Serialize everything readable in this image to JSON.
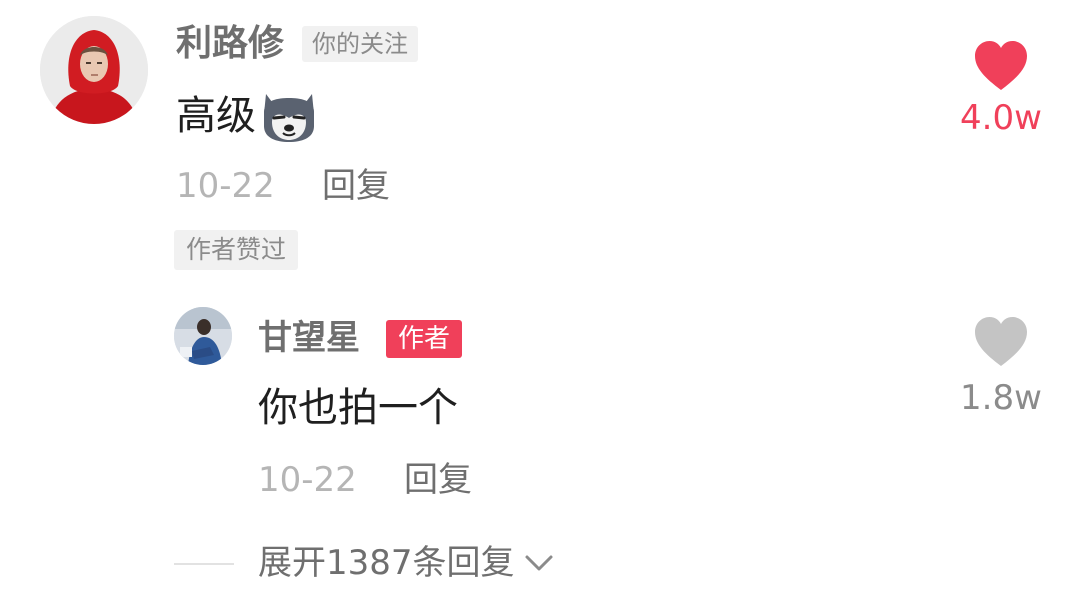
{
  "comment": {
    "username": "利路修",
    "following_tag": "你的关注",
    "text": "高级",
    "emoji_icon": "husky-dog-emoji",
    "date": "10-22",
    "reply_label": "回复",
    "author_liked_tag": "作者赞过",
    "likes": "4.0w",
    "liked": true,
    "like_color": "#f0405a"
  },
  "reply": {
    "username": "甘望星",
    "author_tag": "作者",
    "author_tag_color": "#f0405a",
    "text": "你也拍一个",
    "date": "10-22",
    "reply_label": "回复",
    "likes": "1.8w",
    "liked": false,
    "like_color": "#c4c4c4"
  },
  "expand": {
    "label": "展开1387条回复",
    "icon": "chevron-down-icon"
  }
}
